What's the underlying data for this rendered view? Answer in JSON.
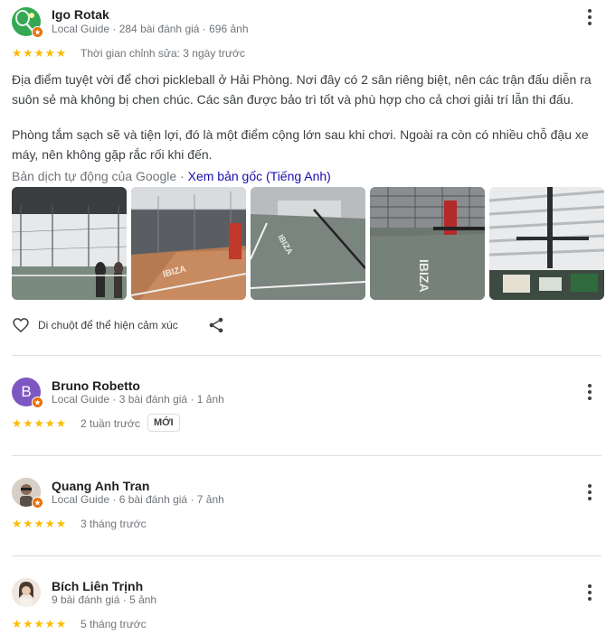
{
  "reviews": [
    {
      "name": "Igo Rotak",
      "meta": "Local Guide · 284 bài đánh giá · 696 ảnh",
      "rating": 5,
      "time": "Thời gian chỉnh sửa: 3 ngày trước",
      "text_p1": "Địa điểm tuyệt vời để chơi pickleball ở Hải Phòng. Nơi đây có 2 sân riêng biệt, nên các trận đấu diễn ra suôn sẻ mà không bị chen chúc. Các sân được bảo trì tốt và phù hợp cho cả chơi giải trí lẫn thi đấu.",
      "text_p2": "Phòng tắm sạch sẽ và tiện lợi, đó là một điểm cộng lớn sau khi chơi. Ngoài ra còn có nhiều chỗ đậu xe máy, nên không gặp rắc rối khi đến.",
      "translate_prefix": "Bản dịch tự động của Google · ",
      "translate_link": "Xem bản gốc (Tiếng Anh)",
      "react_label": "Di chuột để thể hiện cảm xúc",
      "photo_text": "IBIZA"
    },
    {
      "name": "Bruno Robetto",
      "initial": "B",
      "meta": "Local Guide · 3 bài đánh giá · 1 ảnh",
      "rating": 5,
      "time": "2 tuần trước",
      "badge": "MỚI"
    },
    {
      "name": "Quang Anh Tran",
      "meta": "Local Guide · 6 bài đánh giá · 7 ảnh",
      "rating": 5,
      "time": "3 tháng trước"
    },
    {
      "name": "Bích Liên Trịnh",
      "meta": "9 bài đánh giá · 5 ảnh",
      "rating": 5,
      "time": "5 tháng trước"
    }
  ],
  "colors": {
    "star": "#fbbc04",
    "link": "#1a0dab",
    "guide_badge": "#e8710a",
    "avatar_purple": "#7e57c2"
  }
}
